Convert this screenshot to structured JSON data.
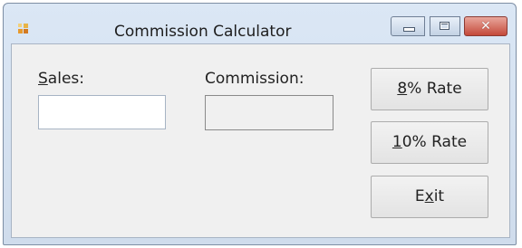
{
  "window": {
    "title": "Commission Calculator",
    "controls": {
      "minimize": "minimize",
      "maximize": "maximize",
      "close": "close"
    }
  },
  "form": {
    "sales_label": {
      "mnemonic": "S",
      "rest": "ales:"
    },
    "sales_value": "",
    "commission_label": "Commission:",
    "commission_value": ""
  },
  "buttons": [
    {
      "mnemonic": "8",
      "rest": "% Rate"
    },
    {
      "mnemonic": "1",
      "rest": "0% Rate"
    },
    {
      "before": "E",
      "mnemonic": "x",
      "rest": "it"
    }
  ],
  "icons": {
    "app": "app-form-icon",
    "minimize": "minimize-icon",
    "maximize": "maximize-icon",
    "close": "close-icon"
  },
  "colors": {
    "title_bar": "#d4e1f1",
    "client_bg": "#f0f0f0",
    "close_button": "#c4493a"
  }
}
